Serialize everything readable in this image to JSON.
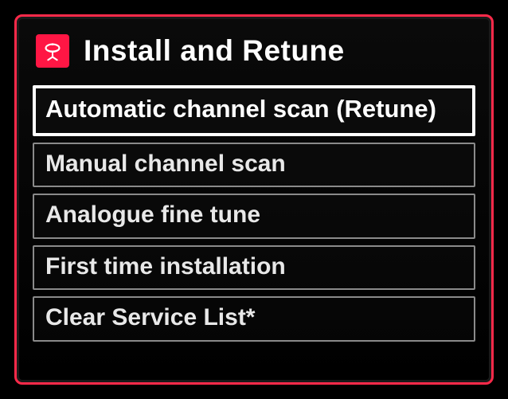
{
  "header": {
    "icon": "satellite-dish-icon",
    "title": "Install and Retune"
  },
  "menu": {
    "items": [
      {
        "label": "Automatic channel scan (Retune)",
        "selected": true
      },
      {
        "label": "Manual channel scan",
        "selected": false
      },
      {
        "label": "Analogue fine tune",
        "selected": false
      },
      {
        "label": "First time installation",
        "selected": false
      },
      {
        "label": "Clear Service List*",
        "selected": false
      }
    ]
  }
}
